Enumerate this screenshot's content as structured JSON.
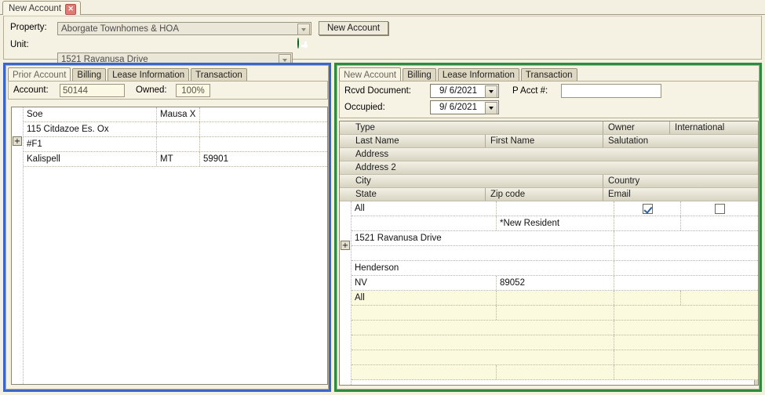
{
  "window": {
    "doc_tab": {
      "label": "New Account",
      "close_icon": "close-icon"
    }
  },
  "header": {
    "property_label": "Property:",
    "property_value": "Aborgate Townhomes & HOA",
    "unit_label": "Unit:",
    "unit_value": "1521 Ravanusa Drive",
    "new_account_button": "New Account",
    "add_icon": "add-circle-icon"
  },
  "left_panel": {
    "accent_color": "#3a66c8",
    "tabs": [
      {
        "label": "Prior Account",
        "active": true
      },
      {
        "label": "Billing",
        "active": false
      },
      {
        "label": "Lease Information",
        "active": false
      },
      {
        "label": "Transaction",
        "active": false
      }
    ],
    "account_label": "Account:",
    "account_value": "50144",
    "owned_label": "Owned:",
    "owned_value": "100%",
    "expander_glyph": "+",
    "grid_rows": [
      {
        "cells": [
          "Soe",
          "Mausa X",
          ""
        ]
      },
      {
        "cells": [
          "115 Citdazoe Es. Ox",
          "",
          ""
        ]
      },
      {
        "cells": [
          "#F1",
          "",
          ""
        ]
      },
      {
        "cells": [
          "Kalispell",
          "MT",
          "59901"
        ]
      }
    ]
  },
  "right_panel": {
    "accent_color": "#2e8b3d",
    "tabs": [
      {
        "label": "New Account",
        "active": true
      },
      {
        "label": "Billing",
        "active": false
      },
      {
        "label": "Lease Information",
        "active": false
      },
      {
        "label": "Transaction",
        "active": false
      }
    ],
    "rcvd_document_label": "Rcvd Document:",
    "rcvd_document_value": "9/  6/2021",
    "occupied_label": "Occupied:",
    "occupied_value": "9/  6/2021",
    "p_acct_label": "P Acct #:",
    "p_acct_value": "",
    "expander_glyph": "+",
    "header_rows": [
      {
        "cells": [
          "Type",
          "",
          "Owner",
          "International"
        ]
      },
      {
        "cells": [
          "Last Name",
          "First Name",
          "Salutation",
          ""
        ]
      },
      {
        "cells": [
          "Address",
          "",
          "",
          ""
        ]
      },
      {
        "cells": [
          "Address 2",
          "",
          "",
          ""
        ]
      },
      {
        "cells": [
          "City",
          "",
          "Country",
          ""
        ]
      },
      {
        "cells": [
          "State",
          "Zip code",
          "Email",
          ""
        ]
      }
    ],
    "data_rows": [
      {
        "cells": [
          "All",
          "",
          "",
          ""
        ],
        "checkbox1": true,
        "checkbox2": false,
        "highlight": false
      },
      {
        "cells": [
          "",
          "*New Resident",
          "",
          ""
        ],
        "highlight": false
      },
      {
        "cells": [
          "1521 Ravanusa Drive",
          "",
          "",
          ""
        ],
        "highlight": false
      },
      {
        "cells": [
          "",
          "",
          "",
          ""
        ],
        "highlight": false
      },
      {
        "cells": [
          "Henderson",
          "",
          "",
          ""
        ],
        "highlight": false
      },
      {
        "cells": [
          "NV",
          "89052",
          "",
          ""
        ],
        "highlight": false
      },
      {
        "cells": [
          "All",
          "",
          "",
          ""
        ],
        "highlight": true
      },
      {
        "cells": [
          "",
          "",
          "",
          ""
        ],
        "highlight": true
      },
      {
        "cells": [
          "",
          "",
          "",
          ""
        ],
        "highlight": true
      },
      {
        "cells": [
          "",
          "",
          "",
          ""
        ],
        "highlight": true
      },
      {
        "cells": [
          "",
          "",
          "",
          ""
        ],
        "highlight": true
      },
      {
        "cells": [
          "",
          "",
          "",
          ""
        ],
        "highlight": true
      }
    ]
  }
}
